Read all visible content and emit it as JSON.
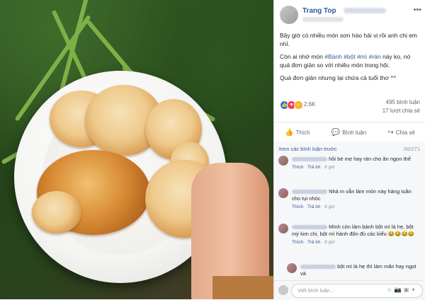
{
  "post": {
    "author": "Trang Top",
    "more": "•••",
    "paragraph1": "Bây giờ có nhiều món sơn hào hải vị rồi anh chị em nhỉ.",
    "p2_a": "Còn ai nhớ món ",
    "p2_tags": "#Bánh #bột #mì #rán",
    "p2_b": " này ko, nó quá đơn giản so với nhiều món trong hội.",
    "paragraph3": "Quá đơn giản nhưng lại chứa cả tuổi thơ ^^"
  },
  "stats": {
    "reactions": "2,6K",
    "comments": "495 bình luận",
    "shares": "17 lượt chia sẻ"
  },
  "actions": {
    "like": "Thích",
    "comment": "Bình luận",
    "share": "Chia sẻ"
  },
  "comments": {
    "view_previous": "Xem các bình luận trước",
    "pager": "56/271",
    "items": [
      {
        "text": "hồi bé mẹ hay rán cho ăn ngon thế",
        "like": "Thích",
        "reply": "Trả lời",
        "time": "8 giờ"
      },
      {
        "text": "Nhà m vẫn làm món này hàng tuần cho tụi nhóc",
        "like": "Thích",
        "reply": "Trả lời",
        "time": "8 giờ"
      },
      {
        "text": "Mình còn làm bánh bột mì lá hẹ, bột mỳ kim chi, bột mì hành độn đủ các kiểu 😂😂😂😂",
        "like": "Thích",
        "reply": "Trả lời",
        "time": "8 giờ"
      },
      {
        "text": "bột mì lá hẹ thì làm mãn hay ngọt và",
        "like": "",
        "reply": "",
        "time": ""
      }
    ]
  },
  "composer": {
    "placeholder": "Viết bình luận..."
  },
  "colors": {
    "link": "#365899",
    "like_reaction": "#1877f2",
    "love_reaction": "#f33e58"
  }
}
